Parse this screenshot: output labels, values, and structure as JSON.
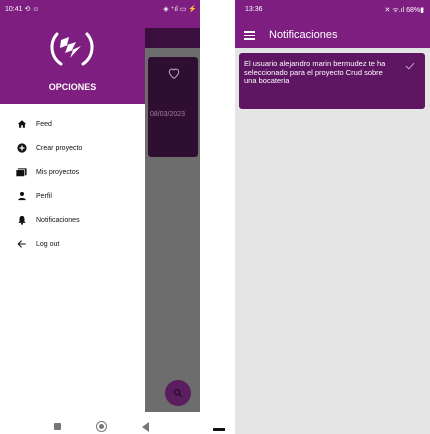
{
  "left_screen": {
    "status_bar": {
      "time": "10:41",
      "left_extra": "⟲ ☺",
      "right": "◈ ⁺ıl ▭ ⚡"
    },
    "drawer": {
      "title": "OPCIONES",
      "items": [
        {
          "label": "Feed",
          "icon": "home-icon"
        },
        {
          "label": "Crear proyecto",
          "icon": "add-circle-icon"
        },
        {
          "label": "Mis proyectos",
          "icon": "folder-icon"
        },
        {
          "label": "Perfil",
          "icon": "person-icon"
        },
        {
          "label": "Notificaciones",
          "icon": "bell-icon"
        },
        {
          "label": "Log out",
          "icon": "arrow-back-icon"
        }
      ]
    },
    "background_card": {
      "date": "08/03/2023"
    }
  },
  "right_screen": {
    "status_bar": {
      "time": "13:36",
      "right": "✕ ᯤ.ıl 68%▮"
    },
    "appbar": {
      "title": "Notificaciones"
    },
    "notifications": [
      {
        "text": "El usuario alejandro marin bermudez te ha seleccionado para el proyecto Crud sobre una bocateria"
      }
    ]
  },
  "colors": {
    "primary": "#7d1e80",
    "card": "#5e1663",
    "scrim": "#6d6d6d"
  }
}
